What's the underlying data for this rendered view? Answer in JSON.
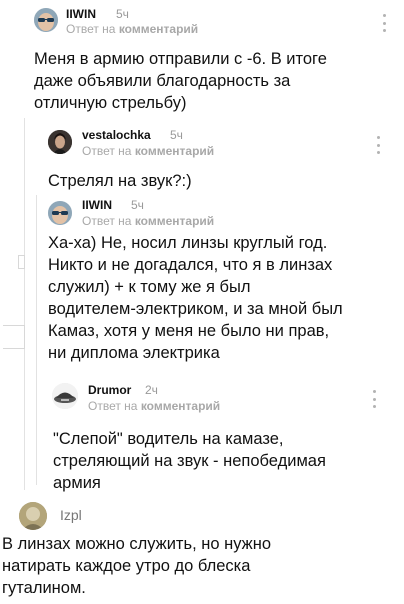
{
  "comments": [
    {
      "user": "IIWIN",
      "time": "5ч",
      "reply_prefix": "Ответ на",
      "reply_target": "комментарий",
      "lines": [
        "Меня в армию отправили с -6. В итоге",
        "даже объявили благодарность за",
        "отличную стрельбу)"
      ]
    },
    {
      "user": "vestalochka",
      "time": "5ч",
      "reply_prefix": "Ответ на",
      "reply_target": "комментарий",
      "lines": [
        "Стрелял на звук?:)"
      ]
    },
    {
      "user": "IIWIN",
      "time": "5ч",
      "reply_prefix": "Ответ на",
      "reply_target": "комментарий",
      "lines": [
        "Ха-ха) Не, носил линзы круглый год.",
        "Никто и не догадался, что я в линзах",
        "служил) + к тому же я был",
        "водителем-электриком, и за мной был",
        "Камаз, хотя у меня не было ни прав,",
        "ни диплома электрика"
      ]
    },
    {
      "user": "Drumor",
      "time": "2ч",
      "reply_prefix": "Ответ на",
      "reply_target": "комментарий",
      "lines": [
        "\"Слепой\" водитель на камазе,",
        "стреляющий на звук  - непобедимая",
        "армия"
      ]
    },
    {
      "user": "Izpl",
      "lines": [
        "В линзах можно служить, но нужно",
        "натирать каждое утро до блеска",
        "гуталином."
      ]
    }
  ],
  "icons": {
    "more": "more-vertical-icon",
    "avatar": "avatar-icon"
  }
}
